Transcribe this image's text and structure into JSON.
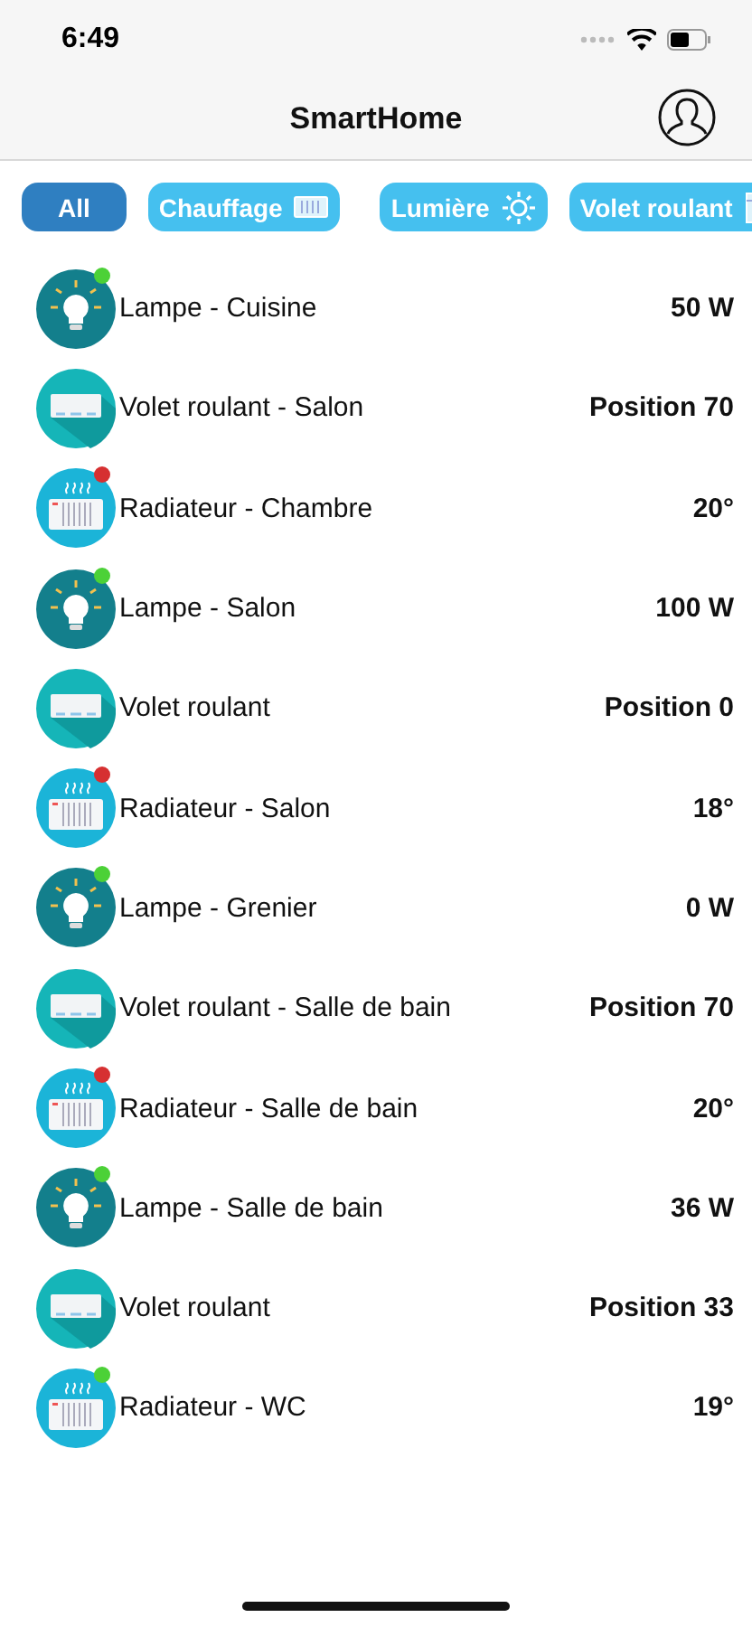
{
  "status_bar": {
    "time": "6:49"
  },
  "nav": {
    "title": "SmartHome"
  },
  "filters": [
    {
      "label": "All",
      "kind": "all",
      "selected": true
    },
    {
      "label": "Chauffage",
      "kind": "heater",
      "selected": false
    },
    {
      "label": "Lumière",
      "kind": "light",
      "selected": false
    },
    {
      "label": "Volet roulant",
      "kind": "shutter",
      "selected": false
    }
  ],
  "devices": [
    {
      "kind": "lamp",
      "name": "Lampe - Cuisine",
      "value": "50 W",
      "color": "#4cd137"
    },
    {
      "kind": "shutter",
      "name": "Volet roulant - Salon",
      "value": "Position 70"
    },
    {
      "kind": "heater",
      "name": "Radiateur - Chambre",
      "value": "20°",
      "color": "#d63031"
    },
    {
      "kind": "lamp",
      "name": "Lampe - Salon",
      "value": "100 W",
      "color": "#4cd137"
    },
    {
      "kind": "shutter",
      "name": "Volet roulant",
      "value": "Position 0"
    },
    {
      "kind": "heater",
      "name": "Radiateur - Salon",
      "value": "18°",
      "color": "#d63031"
    },
    {
      "kind": "lamp",
      "name": "Lampe - Grenier",
      "value": "0 W",
      "color": "#4cd137"
    },
    {
      "kind": "shutter",
      "name": "Volet roulant - Salle de bain",
      "value": "Position 70"
    },
    {
      "kind": "heater",
      "name": "Radiateur - Salle de bain",
      "value": "20°",
      "color": "#d63031"
    },
    {
      "kind": "lamp",
      "name": "Lampe - Salle de bain",
      "value": "36 W",
      "color": "#4cd137"
    },
    {
      "kind": "shutter",
      "name": "Volet roulant",
      "value": "Position 33"
    },
    {
      "kind": "heater",
      "name": "Radiateur - WC",
      "value": "19°",
      "color": "#4cd137"
    }
  ]
}
